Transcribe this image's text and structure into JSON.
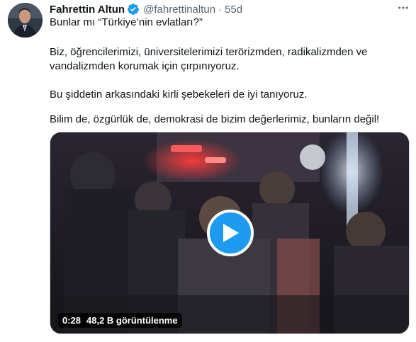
{
  "author": {
    "name": "Fahrettin Altun",
    "handle": "@fahrettinaltun",
    "separator": "·",
    "time": "55d"
  },
  "tweet": {
    "line1": "Bunlar mı “Türkiye’nin evlatları?”",
    "para2": "Biz, öğrencilerimizi, üniversitelerimizi terörizmden, radikalizmden ve vandalizmden korumak için çırpınıyoruz.",
    "para3": "Bu şiddetin arkasındaki kirli şebekeleri de iyi tanıyoruz.",
    "para4": "Bilim de, özgürlük de, demokrasi de bizim değerlerimiz, bunların değil!"
  },
  "video": {
    "duration": "0:28",
    "views": "48,2 B görüntülenme"
  },
  "icons": {
    "verified": "verified-badge-icon",
    "more": "more-options-icon",
    "play": "play-icon"
  },
  "colors": {
    "accent": "#1d9bf0",
    "secondary_text": "#536471"
  }
}
